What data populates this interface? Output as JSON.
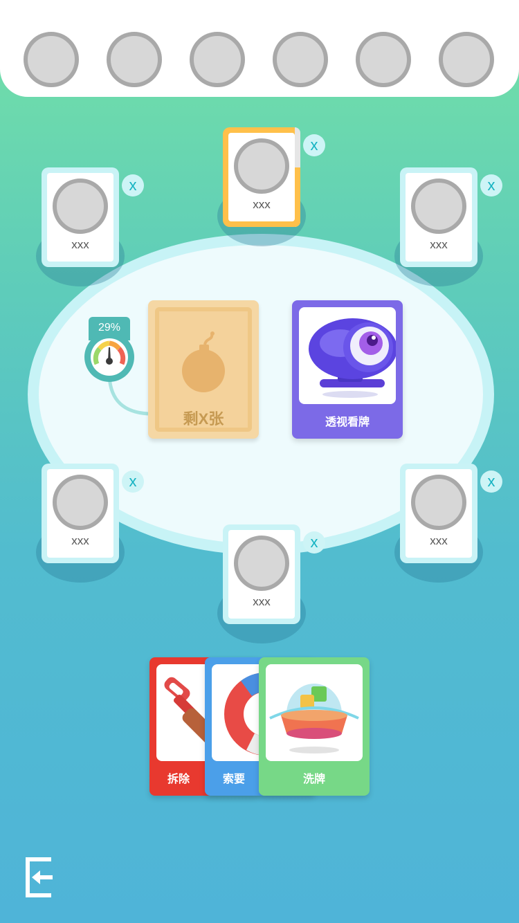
{
  "top_slots": [
    "avatar",
    "avatar",
    "avatar",
    "avatar",
    "avatar",
    "avatar"
  ],
  "players": [
    {
      "name": "xxx",
      "kick": "x",
      "active": true,
      "timer_fraction": 0.6
    },
    {
      "name": "xxx",
      "kick": "x"
    },
    {
      "name": "xxx",
      "kick": "x"
    },
    {
      "name": "xxx",
      "kick": "x"
    },
    {
      "name": "xxx",
      "kick": "x"
    },
    {
      "name": "xxx",
      "kick": "x"
    }
  ],
  "gauge": {
    "percent_label": "29%",
    "value": 0.29
  },
  "deck": {
    "remaining_label": "剩X张",
    "icon": "bomb-icon"
  },
  "table_card": {
    "label": "透视看牌",
    "icon": "eye-camera-icon"
  },
  "hand": [
    {
      "label": "拆除",
      "icon": "shovel-icon"
    },
    {
      "label": "索要",
      "icon": "magnet-icon"
    },
    {
      "label": "洗牌",
      "icon": "shuffle-dome-icon"
    }
  ],
  "colors": {
    "active_seat": "#ffc04a",
    "deck": "#f5d7a4",
    "see_card": "#7c6ae7",
    "remove_card": "#e8392f",
    "ask_card": "#4b9fe9",
    "shuffle_card": "#77d887"
  },
  "exit_icon": "exit-icon"
}
